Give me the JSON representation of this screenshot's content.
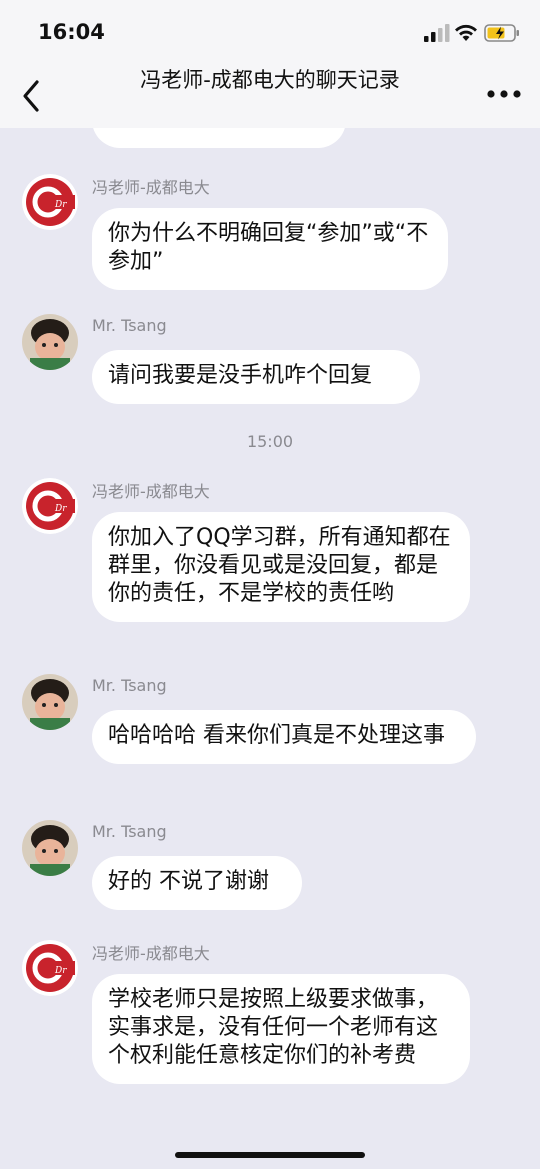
{
  "status": {
    "time": "16:04"
  },
  "nav": {
    "title": "冯老师-成都电大的聊天记录"
  },
  "top_partial": "",
  "messages": [
    {
      "sender": "冯老师-成都电大",
      "text": "你为什么不明确回复“参加”或“不参加”"
    },
    {
      "sender": "Mr. Tsang",
      "text": "请问我要是没手机咋个回复"
    },
    {
      "timestamp": "15:00"
    },
    {
      "sender": "冯老师-成都电大",
      "text": "你加入了QQ学习群，所有通知都在群里，你没看见或是没回复，都是你的责任，不是学校的责任哟"
    },
    {
      "sender": "Mr. Tsang",
      "text": "哈哈哈哈 看来你们真是不处理这事"
    },
    {
      "sender": "Mr. Tsang",
      "text": "好的 不说了谢谢"
    },
    {
      "sender": "冯老师-成都电大",
      "text": "学校老师只是按照上级要求做事，实事求是，没有任何一个老师有这个权利能任意核定你们的补考费"
    }
  ],
  "colors": {
    "background": "#e8e8f2",
    "bubble": "#ffffff",
    "logo_red": "#c8232c"
  },
  "icons": {
    "back": "chevron-left-icon",
    "more": "more-dots-icon",
    "signal": "signal-icon",
    "wifi": "wifi-icon",
    "battery": "battery-charging-icon"
  }
}
